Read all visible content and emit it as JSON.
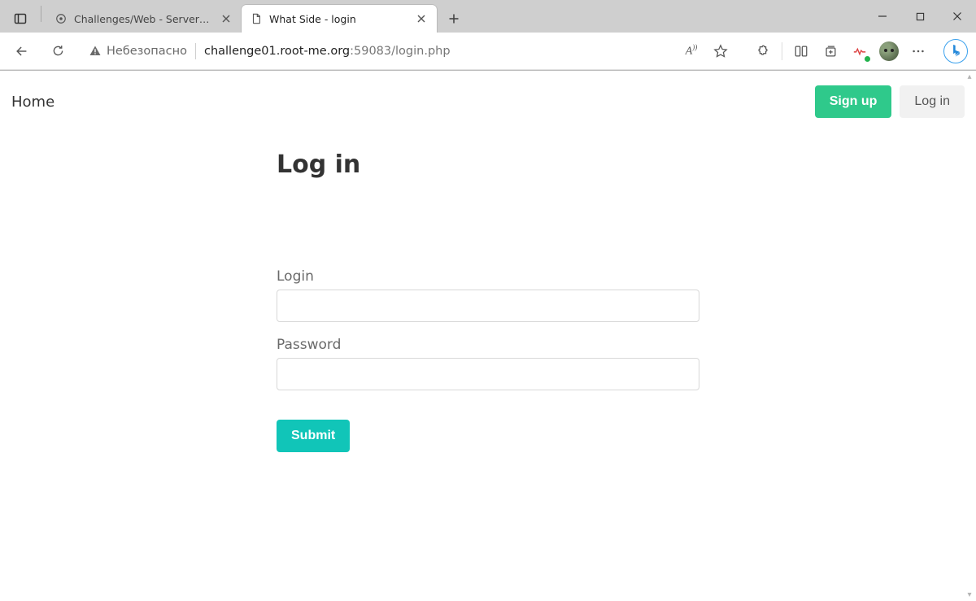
{
  "window": {
    "tabs": [
      {
        "title": "Challenges/Web - Server : XSS - ",
        "active": false
      },
      {
        "title": "What Side - login",
        "active": true
      }
    ]
  },
  "address_bar": {
    "security_label": "Небезопасно",
    "host": "challenge01.root-me.org",
    "port_path": ":59083/login.php"
  },
  "page": {
    "nav": {
      "home_label": "Home",
      "signup_label": "Sign up",
      "login_label": "Log in"
    },
    "form": {
      "heading": "Log in",
      "login_label": "Login",
      "password_label": "Password",
      "login_value": "",
      "password_value": "",
      "submit_label": "Submit"
    }
  }
}
